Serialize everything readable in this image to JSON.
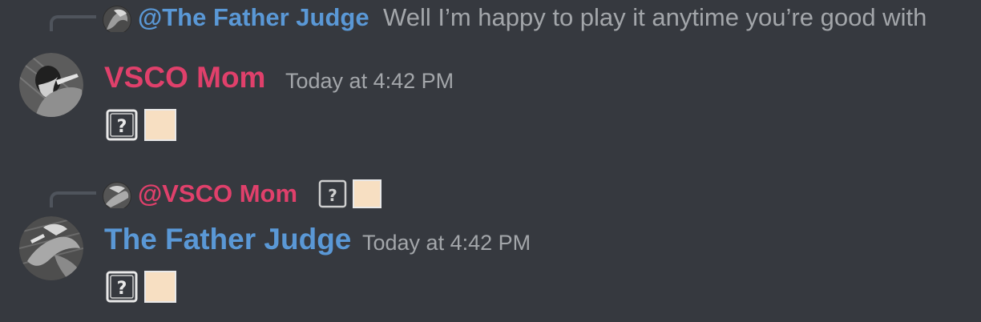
{
  "messages": [
    {
      "reply": {
        "mention": "@The Father Judge",
        "mention_color": "#5a98d6",
        "preview_text": "Well I’m happy to play it anytime you’re good with"
      },
      "author": "VSCO Mom",
      "author_color": "#e0406b",
      "timestamp": "Today at 4:42 PM",
      "content_glyphs": [
        "unknown-emoji-icon",
        "skin-tone-swatch-icon"
      ]
    },
    {
      "reply": {
        "mention": "@VSCO Mom",
        "mention_color": "#e0406b",
        "preview_glyphs": [
          "unknown-emoji-icon",
          "skin-tone-swatch-icon"
        ]
      },
      "author": "The Father Judge",
      "author_color": "#5a98d6",
      "timestamp": "Today at 4:42 PM",
      "content_glyphs": [
        "unknown-emoji-icon",
        "skin-tone-swatch-icon"
      ]
    }
  ],
  "colors": {
    "background": "#36393f",
    "muted_text": "#a3a6aa",
    "swatch": "#f7dfc2"
  }
}
